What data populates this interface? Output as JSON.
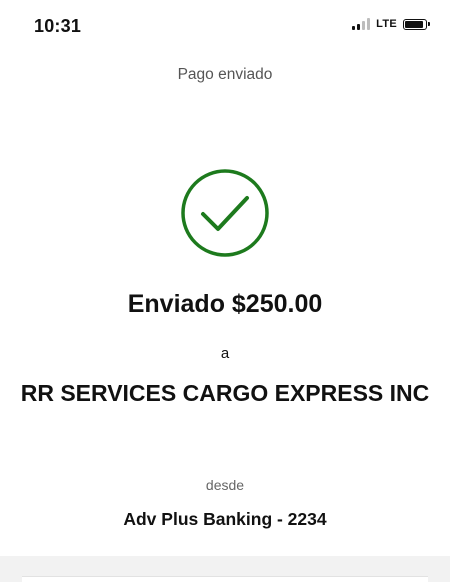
{
  "status_bar": {
    "time": "10:31",
    "network": "LTE",
    "signal_icon": "cellular-signal-icon",
    "signal_bars_filled": 2,
    "signal_bars_total": 4,
    "battery_icon": "battery-icon",
    "battery_level": 0.9
  },
  "header": {
    "title": "Pago enviado"
  },
  "confirmation": {
    "icon": "checkmark-circle-icon",
    "accent_color": "#1d7a1d",
    "amount_text": "Enviado $250.00",
    "to_label": "a",
    "recipient": "RR SERVICES CARGO EXPRESS INC",
    "from_label": "desde",
    "source_account": "Adv Plus Banking - 2234"
  }
}
